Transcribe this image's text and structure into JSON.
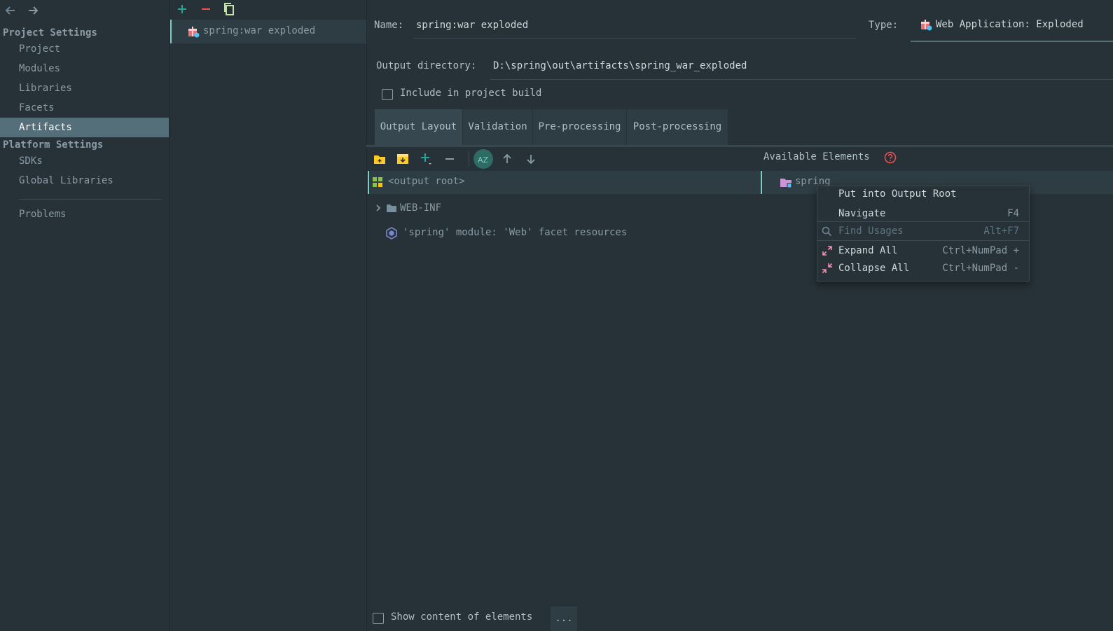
{
  "nav": {
    "back_icon": "arrow-left-icon",
    "forward_icon": "arrow-right-icon",
    "project_settings_header": "Project Settings",
    "project_items": [
      "Project",
      "Modules",
      "Libraries",
      "Facets",
      "Artifacts"
    ],
    "selected_item": "Artifacts",
    "platform_settings_header": "Platform Settings",
    "platform_items": [
      "SDKs",
      "Global Libraries"
    ],
    "problems": "Problems"
  },
  "artifacts_list": {
    "add_icon": "plus-icon",
    "remove_icon": "minus-icon",
    "copy_icon": "copy-icon",
    "items": [
      "spring:war exploded"
    ]
  },
  "form": {
    "name_label": "Name:",
    "name_value": "spring:war exploded",
    "type_label": "Type:",
    "type_value": "Web Application: Exploded",
    "output_dir_label": "Output directory:",
    "output_dir_value": "D:\\spring\\out\\artifacts\\spring_war_exploded",
    "include_build_label": "Include in project build",
    "include_build_checked": false
  },
  "tabs": [
    "Output Layout",
    "Validation",
    "Pre-processing",
    "Post-processing"
  ],
  "selected_tab": "Output Layout",
  "layout_toolbar": {
    "icons": [
      "new-folder-icon",
      "archive-icon",
      "add-icon",
      "remove-icon",
      "sort-az-icon",
      "move-up-icon",
      "move-down-icon"
    ]
  },
  "tree": {
    "root": "<output root>",
    "children": [
      "WEB-INF",
      "'spring' module: 'Web' facet resources"
    ]
  },
  "available": {
    "title": "Available Elements",
    "help_icon": "question-icon",
    "items": [
      "spring"
    ]
  },
  "context_menu": {
    "items": [
      {
        "label": "Put into Output Root",
        "shortcut": "",
        "enabled": true
      },
      {
        "label": "Navigate",
        "shortcut": "F4",
        "enabled": true
      },
      {
        "label": "Find Usages",
        "shortcut": "Alt+F7",
        "enabled": false
      },
      {
        "label": "Expand All",
        "shortcut": "Ctrl+NumPad +",
        "enabled": true
      },
      {
        "label": "Collapse All",
        "shortcut": "Ctrl+NumPad -",
        "enabled": true
      }
    ]
  },
  "bottom": {
    "show_content_label": "Show content of elements",
    "show_content_checked": false,
    "more_button": "..."
  },
  "colors": {
    "background": "#263238",
    "selection": "#546e7a",
    "accent": "#80cbc4",
    "add_green": "#26a69a",
    "remove_red": "#ef5350"
  }
}
